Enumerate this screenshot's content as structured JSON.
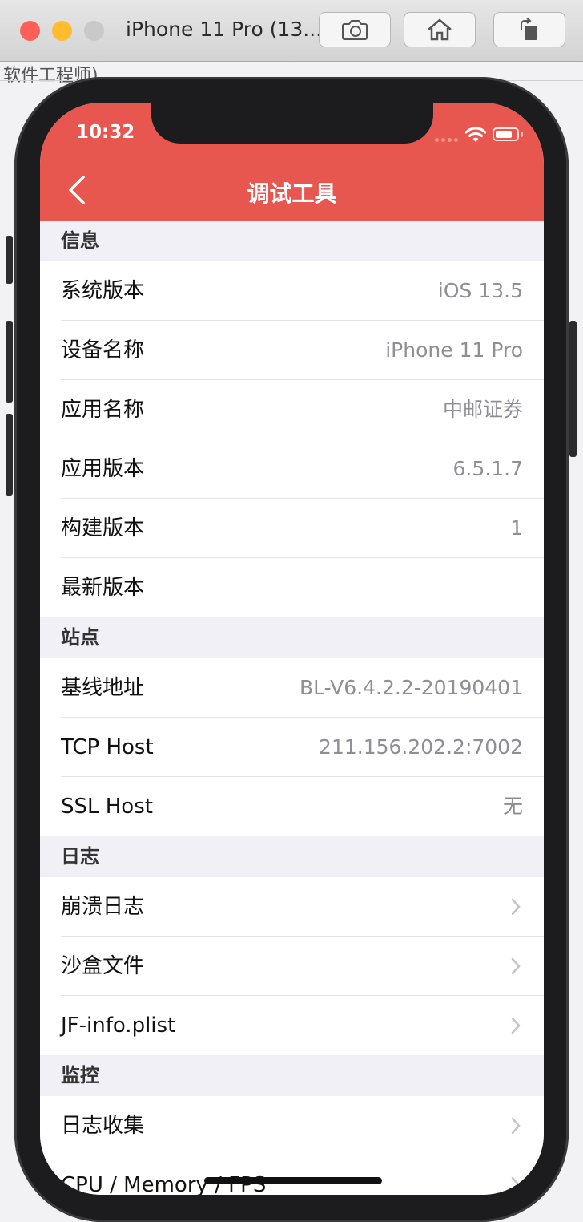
{
  "simulator": {
    "title": "iPhone 11 Pro (13...",
    "screenshot_icon": "camera-icon",
    "home_icon": "home-icon",
    "rotate_icon": "rotate-icon"
  },
  "background_window": {
    "text": "软件工程师)"
  },
  "status_bar": {
    "time": "10:32"
  },
  "nav": {
    "title": "调试工具",
    "back_icon": "back-chevron-icon"
  },
  "colors": {
    "header": "#e8574f",
    "section_bg": "#f1f0f6",
    "value_text": "#8e8e93"
  },
  "sections": {
    "info": {
      "title": "信息",
      "rows": [
        {
          "label": "系统版本",
          "value": "iOS 13.5"
        },
        {
          "label": "设备名称",
          "value": "iPhone 11 Pro"
        },
        {
          "label": "应用名称",
          "value": "中邮证券"
        },
        {
          "label": "应用版本",
          "value": "6.5.1.7"
        },
        {
          "label": "构建版本",
          "value": "1"
        },
        {
          "label": "最新版本",
          "value": ""
        }
      ]
    },
    "site": {
      "title": "站点",
      "rows": [
        {
          "label": "基线地址",
          "value": "BL-V6.4.2.2-20190401"
        },
        {
          "label": "TCP Host",
          "value": "211.156.202.2:7002"
        },
        {
          "label": "SSL Host",
          "value": "无"
        }
      ]
    },
    "log": {
      "title": "日志",
      "rows": [
        {
          "label": "崩溃日志"
        },
        {
          "label": "沙盒文件"
        },
        {
          "label": "JF-info.plist"
        }
      ]
    },
    "monitor": {
      "title": "监控",
      "rows": [
        {
          "label": "日志收集"
        },
        {
          "label": "CPU / Memory / FPS"
        }
      ]
    }
  }
}
